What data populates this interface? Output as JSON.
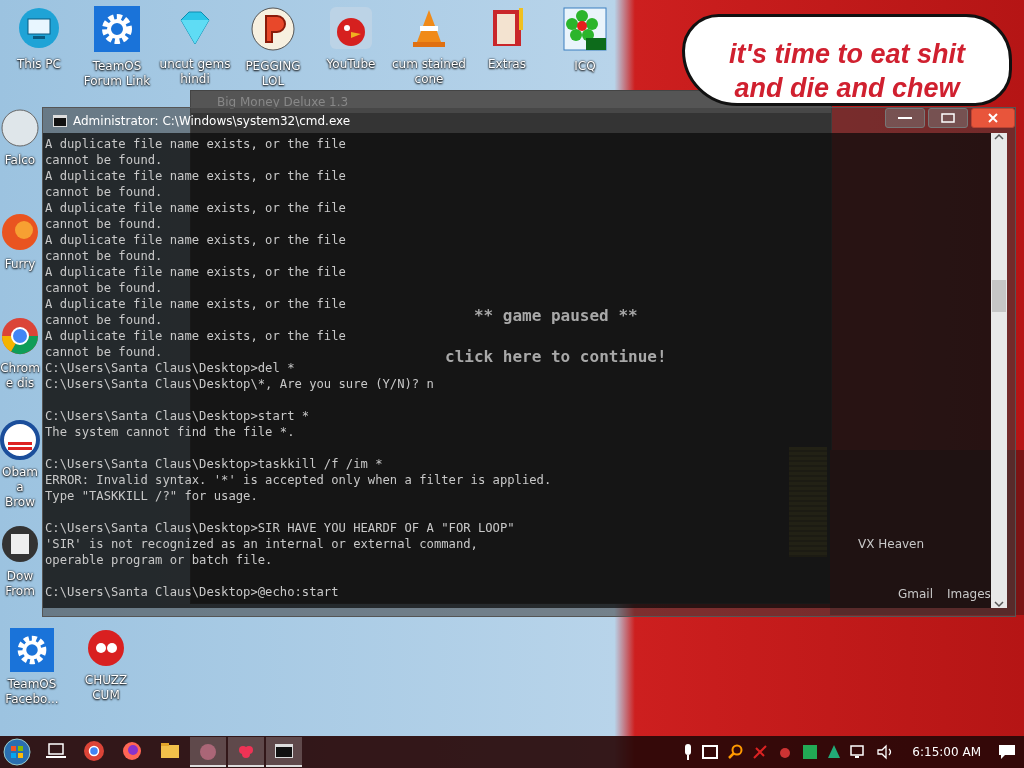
{
  "desktop_icons_top": [
    {
      "label": "This PC"
    },
    {
      "label": "TeamOS Forum Link"
    },
    {
      "label": "uncut gems hindi"
    },
    {
      "label": "PEGGING LOL"
    },
    {
      "label": "YouTube"
    },
    {
      "label": "cum stained cone"
    },
    {
      "label": "Extras"
    },
    {
      "label": "ICQ"
    }
  ],
  "desktop_icons_left": [
    {
      "label": "Falco"
    },
    {
      "label": "Furry"
    },
    {
      "label": "Chrome dis"
    },
    {
      "label": "Obama Brow"
    },
    {
      "label": "Dow From"
    },
    {
      "label": "TeamOS Facebo..."
    },
    {
      "label": "CHUZZ CUM"
    }
  ],
  "speech_bubble": {
    "lines": [
      "it's time to eat shit",
      "and die and chew"
    ]
  },
  "background_windows": {
    "game_title": "Big Money Deluxe 1.3",
    "paused": "** game paused **",
    "continue": "click here to continue!",
    "browser_link": "VX Heaven",
    "browser_links": [
      "Gmail",
      "Images"
    ]
  },
  "cmd_window": {
    "title": "Administrator: C:\\Windows\\system32\\cmd.exe",
    "blocks": [
      {
        "lines": [
          "A duplicate file name exists, or the file",
          "cannot be found.",
          "A duplicate file name exists, or the file",
          "cannot be found.",
          "A duplicate file name exists, or the file",
          "cannot be found.",
          "A duplicate file name exists, or the file",
          "cannot be found.",
          "A duplicate file name exists, or the file",
          "cannot be found.",
          "A duplicate file name exists, or the file",
          "cannot be found.",
          "A duplicate file name exists, or the file",
          "cannot be found.",
          "C:\\Users\\Santa Claus\\Desktop>del *",
          "C:\\Users\\Santa Claus\\Desktop\\*, Are you sure (Y/N)? n"
        ]
      },
      {
        "lines": [
          "C:\\Users\\Santa Claus\\Desktop>start *",
          "The system cannot find the file *."
        ]
      },
      {
        "lines": [
          "C:\\Users\\Santa Claus\\Desktop>taskkill /f /im *",
          "ERROR: Invalid syntax. '*' is accepted only when a filter is applied.",
          "Type \"TASKKILL /?\" for usage."
        ]
      },
      {
        "lines": [
          "C:\\Users\\Santa Claus\\Desktop>SIR HAVE YOU HEARDF OF A \"FOR LOOP\"",
          "'SIR' is not recognized as an internal or external command,",
          "operable program or batch file."
        ]
      },
      {
        "lines": [
          "C:\\Users\\Santa Claus\\Desktop>@echo:start"
        ]
      }
    ]
  },
  "taskbar": {
    "apps": [
      {
        "selected": false
      },
      {
        "selected": false
      },
      {
        "selected": false
      },
      {
        "selected": false
      },
      {
        "selected": true
      },
      {
        "selected": true
      },
      {
        "selected": true
      }
    ],
    "clock": "6:15:00 AM"
  }
}
